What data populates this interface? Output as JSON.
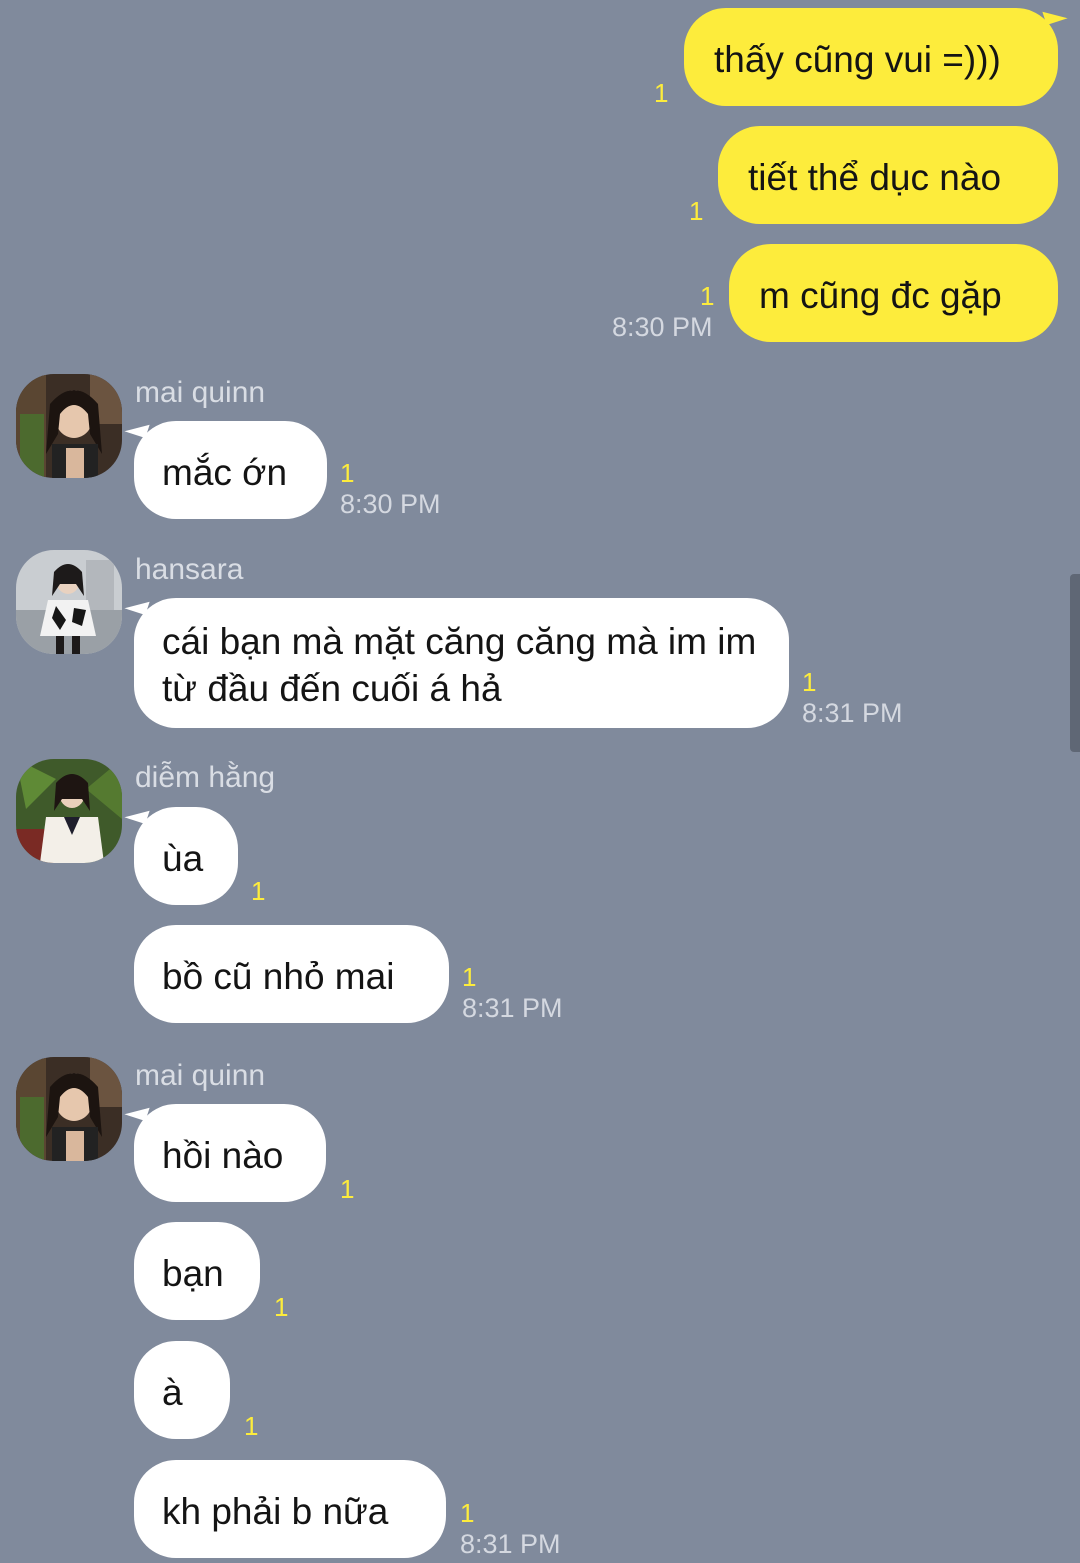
{
  "colors": {
    "background": "#808a9c",
    "my_bubble": "#fdec3c",
    "their_bubble": "#ffffff",
    "unread_count": "#fdec3c",
    "timestamp": "#d4d8e0"
  },
  "messages": [
    {
      "from": "me",
      "text": "thấy cũng vui =)))",
      "unread": "1",
      "time": ""
    },
    {
      "from": "me",
      "text": "tiết thể dục nào",
      "unread": "1",
      "time": ""
    },
    {
      "from": "me",
      "text": "m cũng đc gặp",
      "unread": "1",
      "time": "8:30 PM"
    },
    {
      "from": "mai quinn",
      "text": "mắc ớn",
      "unread": "1",
      "time": "8:30 PM"
    },
    {
      "from": "hansara",
      "text": "cái bạn mà mặt căng căng mà im im từ đầu đến cuối á hả",
      "unread": "1",
      "time": "8:31 PM"
    },
    {
      "from": "diễm hằng",
      "text": "ùa",
      "unread": "1",
      "time": ""
    },
    {
      "from": "diễm hằng",
      "text": "bồ cũ nhỏ mai",
      "unread": "1",
      "time": "8:31 PM"
    },
    {
      "from": "mai quinn",
      "text": "hồi nào",
      "unread": "1",
      "time": ""
    },
    {
      "from": "mai quinn",
      "text": "bạn",
      "unread": "1",
      "time": ""
    },
    {
      "from": "mai quinn",
      "text": "à",
      "unread": "1",
      "time": ""
    },
    {
      "from": "mai quinn",
      "text": "kh phải b nữa",
      "unread": "1",
      "time": "8:31 PM"
    }
  ],
  "senders": {
    "mai_quinn_1": "mai quinn",
    "hansara": "hansara",
    "diem_hang": "diễm hằng",
    "mai_quinn_2": "mai quinn"
  }
}
